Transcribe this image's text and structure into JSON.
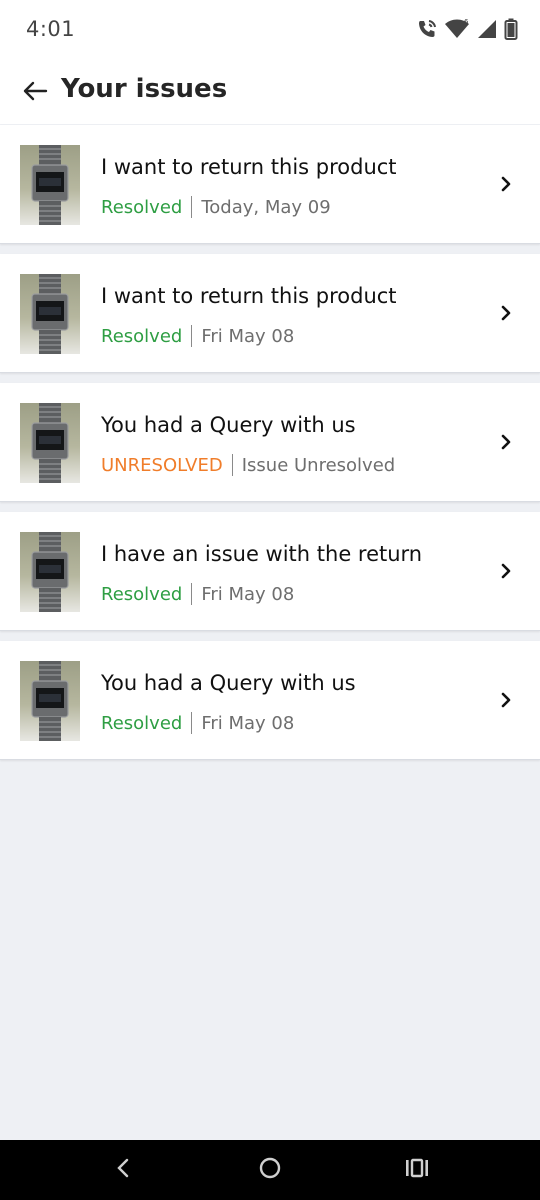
{
  "status_bar": {
    "time": "4:01",
    "icons": [
      "wifi-calling-icon",
      "wifi-icon",
      "signal-icon",
      "battery-icon"
    ]
  },
  "header": {
    "title": "Your issues",
    "back_icon": "arrow-left-icon"
  },
  "colors": {
    "resolved": "#2e9e43",
    "unresolved": "#f07d2a",
    "date": "#6e6e6e",
    "page_bg": "#eef0f4"
  },
  "issues": [
    {
      "title": "I want to return this product",
      "status": "Resolved",
      "status_type": "resolved",
      "date": "Today, May 09"
    },
    {
      "title": "I want to return this product",
      "status": "Resolved",
      "status_type": "resolved",
      "date": "Fri May 08"
    },
    {
      "title": "You had a Query with us",
      "status": "UNRESOLVED",
      "status_type": "unresolved",
      "date": "Issue Unresolved"
    },
    {
      "title": "I have an issue with the return",
      "status": "Resolved",
      "status_type": "resolved",
      "date": "Fri May 08"
    },
    {
      "title": "You had a Query with us",
      "status": "Resolved",
      "status_type": "resolved",
      "date": "Fri May 08"
    }
  ],
  "nav_bar": {
    "icons": [
      "nav-back-icon",
      "nav-home-icon",
      "nav-recents-icon"
    ]
  }
}
